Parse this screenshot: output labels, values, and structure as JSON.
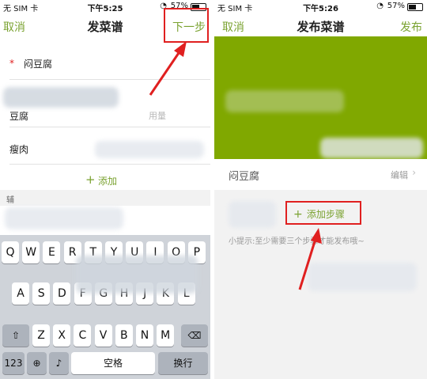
{
  "left": {
    "status": {
      "carrier": "无 SIM 卡",
      "time": "下午5:25",
      "battery": "57%"
    },
    "nav": {
      "cancel": "取消",
      "title": "发菜谱",
      "next": "下一步"
    },
    "form": {
      "required_mark": "*",
      "dish_name": "闷豆腐",
      "ingredient_1": "豆腐",
      "amount_placeholder": "用量",
      "ingredient_2": "瘦肉",
      "add_label": "添加",
      "aux_label": "辅"
    },
    "keyboard": {
      "row1": [
        "Q",
        "W",
        "E",
        "R",
        "T",
        "Y",
        "U",
        "I",
        "O",
        "P"
      ],
      "row2": [
        "A",
        "S",
        "D",
        "F",
        "G",
        "H",
        "J",
        "K",
        "L"
      ],
      "row3": [
        "Z",
        "X",
        "C",
        "V",
        "B",
        "N",
        "M"
      ],
      "numbers_key": "123",
      "space_key": "空格",
      "return_key": "换行"
    }
  },
  "right": {
    "status": {
      "carrier": "无 SIM 卡",
      "time": "下午5:26",
      "battery": "57%"
    },
    "nav": {
      "cancel": "取消",
      "title": "发布菜谱",
      "publish": "发布"
    },
    "dish_name": "闷豆腐",
    "edit_label": "编辑",
    "add_step": "添加步骤",
    "hint": "小提示:至少需要三个步骤才能发布哦~"
  },
  "colors": {
    "accent": "#7aa230",
    "header_green": "#80a800",
    "highlight_red": "#e02020"
  }
}
